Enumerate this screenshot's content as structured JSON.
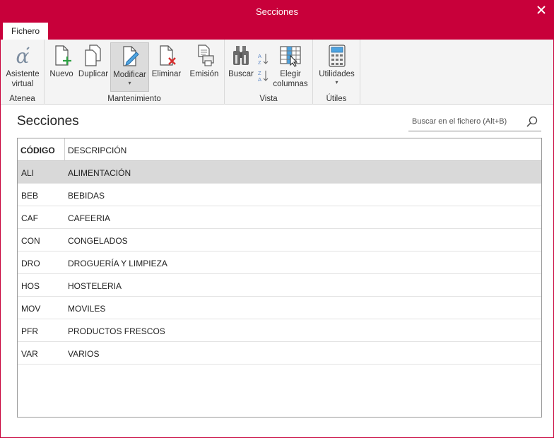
{
  "window": {
    "title": "Secciones",
    "accent": "#c8003a"
  },
  "tabs": [
    {
      "label": "Fichero"
    }
  ],
  "ribbon": {
    "groups": [
      {
        "label": "Atenea",
        "buttons": [
          {
            "label1": "Asistente",
            "label2": "virtual",
            "icon": "alpha-assistant-icon"
          }
        ]
      },
      {
        "label": "Mantenimiento",
        "buttons": [
          {
            "label": "Nuevo",
            "icon": "new-document-icon"
          },
          {
            "label": "Duplicar",
            "icon": "duplicate-icon"
          },
          {
            "label": "Modificar",
            "icon": "edit-document-icon"
          },
          {
            "label": "Eliminar",
            "icon": "delete-document-icon"
          },
          {
            "label": "Emisión",
            "icon": "print-icon"
          }
        ]
      },
      {
        "label": "Vista",
        "buttons": [
          {
            "label": "Buscar",
            "icon": "binoculars-icon"
          },
          {
            "label1": "Elegir",
            "label2": "columnas",
            "icon": "choose-columns-icon"
          }
        ]
      },
      {
        "label": "Útiles",
        "buttons": [
          {
            "label": "Utilidades",
            "icon": "calculator-icon"
          }
        ]
      }
    ]
  },
  "main": {
    "heading": "Secciones",
    "search": {
      "placeholder": "Buscar en el fichero (Alt+B)"
    }
  },
  "table": {
    "columns": [
      "CÓDIGO",
      "DESCRIPCIÓN"
    ],
    "rows": [
      {
        "code": "ALI",
        "desc": "ALIMENTACIÓN",
        "selected": true
      },
      {
        "code": "BEB",
        "desc": "BEBIDAS"
      },
      {
        "code": "CAF",
        "desc": "CAFEERIA"
      },
      {
        "code": "CON",
        "desc": "CONGELADOS"
      },
      {
        "code": "DRO",
        "desc": "DROGUERÍA Y LIMPIEZA"
      },
      {
        "code": "HOS",
        "desc": "HOSTELERIA"
      },
      {
        "code": "MOV",
        "desc": "MOVILES"
      },
      {
        "code": "PFR",
        "desc": "PRODUCTOS FRESCOS"
      },
      {
        "code": "VAR",
        "desc": "VARIOS"
      }
    ]
  }
}
